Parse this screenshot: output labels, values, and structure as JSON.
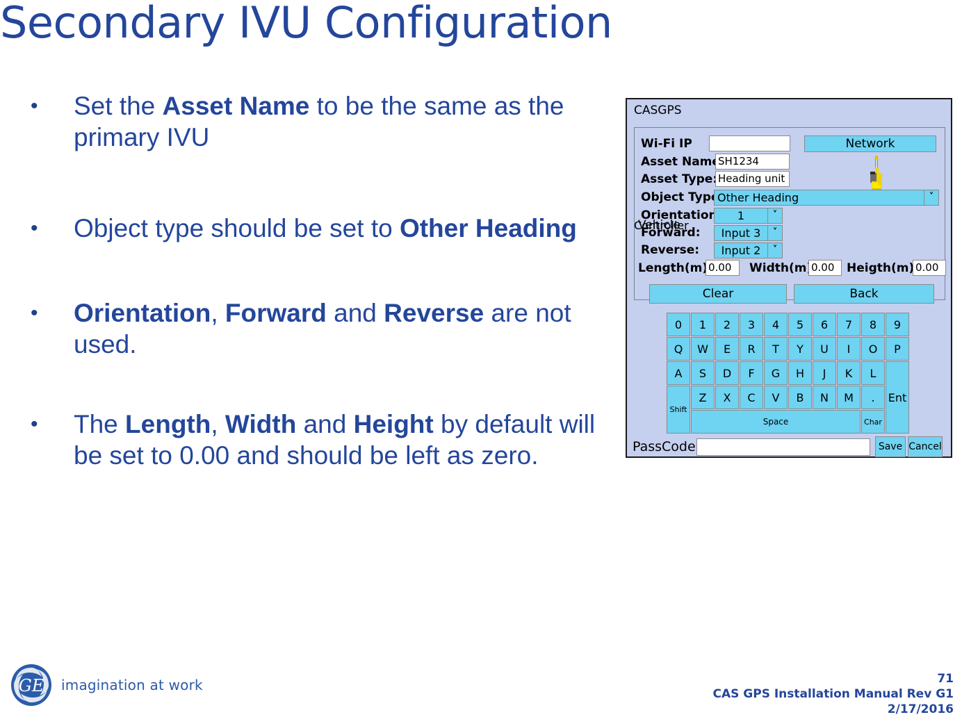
{
  "slide": {
    "title": "Secondary IVU Configuration"
  },
  "bullets": [
    {
      "marker": "•",
      "html": "Set the <b>Asset Name</b> to be the same as the primary IVU"
    },
    {
      "marker": "•",
      "html": "Object type should be set to <b>Other Heading</b>"
    },
    {
      "marker": "•",
      "html": "<b>Orientation</b>, <b>Forward</b> and <b>Reverse</b> are not used."
    },
    {
      "marker": "•",
      "html": "The <b>Length</b>, <b>Width</b> and <b>Height</b> by default will be set to 0.00 and should be left as zero."
    }
  ],
  "dialog": {
    "window_title": "CASGPS",
    "group_label_back": "Controller",
    "group_label_front": "Vehicle",
    "fields": {
      "wifi_ip_label": "Wi-Fi IP",
      "wifi_ip_value": "",
      "asset_name_label": "Asset Name:",
      "asset_name_value": "SH1234",
      "asset_type_label": "Asset Type:",
      "asset_type_value": "Heading unit",
      "object_type_label": "Object Type:",
      "object_type_value": "Other Heading",
      "orientation_label": "Orientation:",
      "orientation_value": "1",
      "forward_label": "Forward:",
      "forward_value": "Input 3",
      "reverse_label": "Reverse:",
      "reverse_value": "Input 2",
      "length_label": "Length(m):",
      "length_value": "0.00",
      "width_label": "Width(m):",
      "width_value": "0.00",
      "height_label": "Heigth(m):",
      "height_value": "0.00",
      "dropdown_arrow": "˅"
    },
    "network_button": "Network",
    "clear_button": "Clear",
    "back_button": "Back",
    "passcode_label": "PassCode:",
    "passcode_value": "",
    "save_button": "Save",
    "cancel_button": "Cancel",
    "keyboard": {
      "row_digits": [
        "0",
        "1",
        "2",
        "3",
        "4",
        "5",
        "6",
        "7",
        "8",
        "9"
      ],
      "row_top": [
        "Q",
        "W",
        "E",
        "R",
        "T",
        "Y",
        "U",
        "I",
        "O",
        "P"
      ],
      "row_home": [
        "A",
        "S",
        "D",
        "F",
        "G",
        "H",
        "J",
        "K",
        "L"
      ],
      "row_bottom": [
        "Z",
        "X",
        "C",
        "V",
        "B",
        "N",
        "M",
        "."
      ],
      "shift": "Shift",
      "space": "Space",
      "char": "Char",
      "enter": "Ent"
    },
    "colors": {
      "dialog_bg": "#c5cfee",
      "control_blue": "#6fd3f2",
      "border": "#8b8b8b",
      "text": "#000000"
    }
  },
  "footer": {
    "tagline": "imagination at work",
    "page_number": "71",
    "manual": "CAS GPS Installation Manual Rev G1",
    "date": "2/17/2016"
  },
  "theme": {
    "title_blue": "#24469b",
    "body_blue": "#24469b"
  }
}
